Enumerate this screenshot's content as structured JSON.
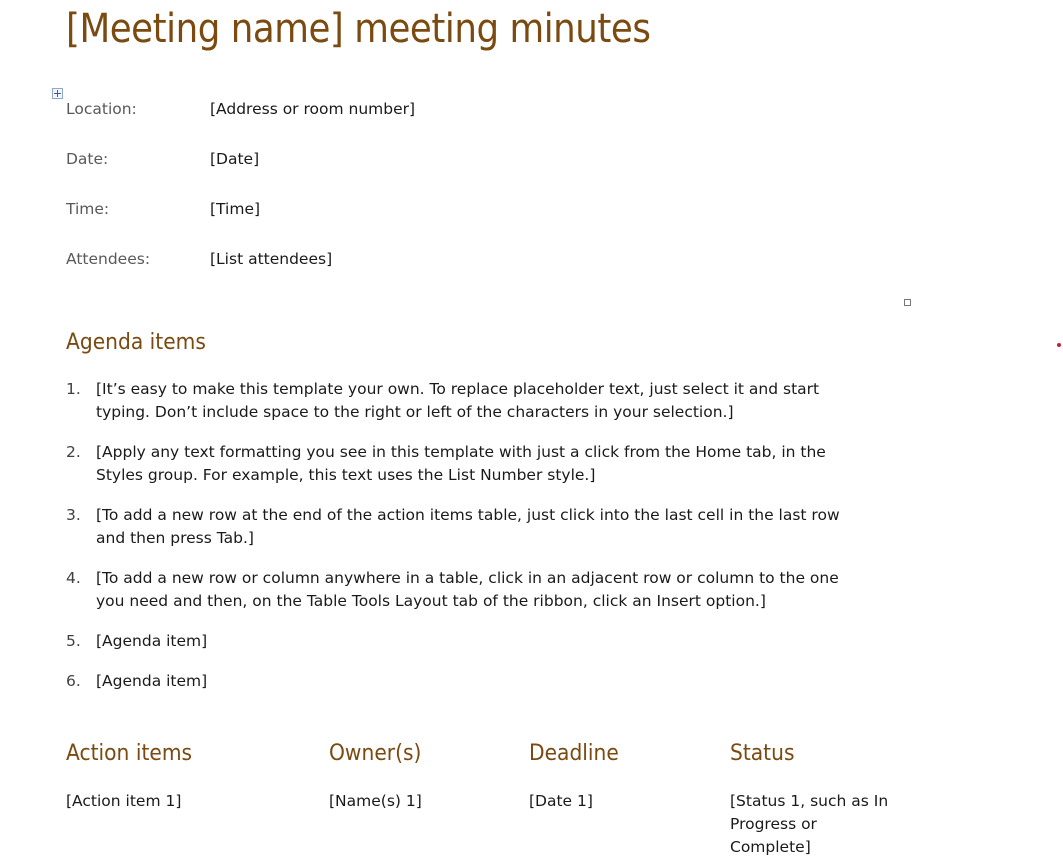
{
  "document": {
    "title": "[Meeting name] meeting minutes",
    "details": [
      {
        "label": "Location:",
        "value": "[Address or room number]"
      },
      {
        "label": "Date:",
        "value": "[Date]"
      },
      {
        "label": "Time:",
        "value": "[Time]"
      },
      {
        "label": "Attendees:",
        "value": "[List attendees]"
      }
    ],
    "agenda": {
      "heading": "Agenda items",
      "items": [
        {
          "number": "1.",
          "text": "[It’s easy to make this template your own. To replace placeholder text, just select it and start\ntyping. Don’t include space to the right or left of the characters in your selection.]"
        },
        {
          "number": "2.",
          "text": "[Apply any text formatting you see in this template with just a click from the Home tab, in the\nStyles group. For example, this text uses the List Number style.]"
        },
        {
          "number": "3.",
          "text": "[To add a new row at the end of the action items table, just click into the last cell in the last row\nand then press Tab.]"
        },
        {
          "number": "4.",
          "text": "[To add a new row or column anywhere in a table, click in an adjacent row or column to the one\nyou need and then, on the Table Tools Layout tab of the ribbon, click an Insert option.]"
        },
        {
          "number": "5.",
          "text": "[Agenda item]"
        },
        {
          "number": "6.",
          "text": "[Agenda item]"
        }
      ]
    },
    "action_items": {
      "columns": [
        "Action items",
        "Owner(s)",
        "Deadline",
        "Status"
      ],
      "rows": [
        [
          "[Action item 1]",
          "[Name(s) 1]",
          "[Date 1]",
          "[Status 1, such as In\nProgress or\nComplete]"
        ]
      ]
    }
  },
  "icons": {
    "table_move_handle": "move-cross-icon",
    "resize_handle": "square-handle-icon",
    "marker": "red-dot-icon"
  },
  "colors": {
    "heading": "#7a4a10",
    "label": "#595959",
    "body_text": "#1a1a1a"
  }
}
